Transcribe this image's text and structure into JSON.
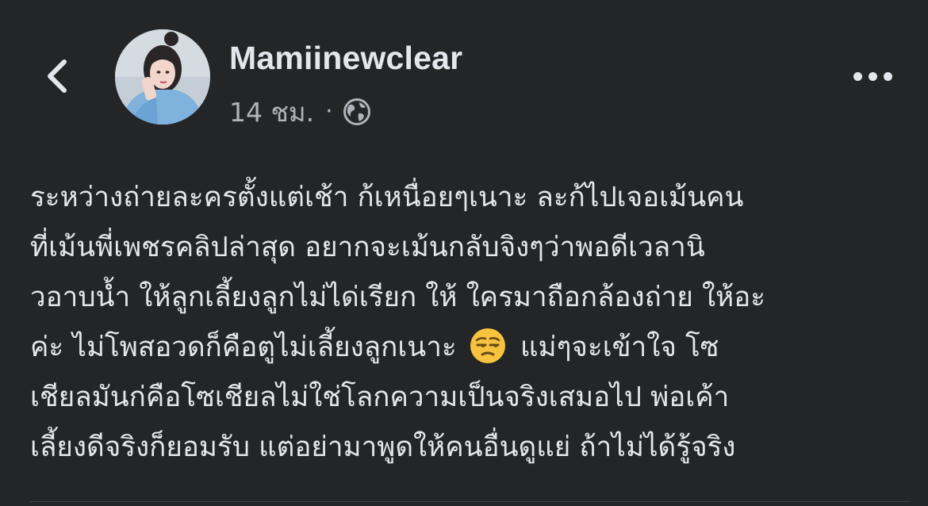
{
  "header": {
    "back_icon": "chevron-left-icon",
    "author_name": "Mamiinewclear",
    "timestamp": "14 ชม.",
    "separator": "·",
    "privacy_icon": "globe-icon",
    "more_icon": "more-horizontal-icon"
  },
  "post": {
    "lines": [
      "ระหว่างถ่ายละครตั้งแต่เช้า ก้เหนื่อยๆเนาะ ละก้ไปเจอเม้นคน",
      "ที่เม้นพี่เพชรคลิปล่าสุด อยากจะเม้นกลับจิงๆว่าพอดีเวลานิ",
      "วอาบน้ำ ให้ลูกเลี้ยงลูกไม่ได่เรียก ให้ ใครมาถือกล้องถ่าย ให้อะ"
    ],
    "line4_before": "ค่ะ ไม่โพสอวดก็คือตูไม่เลี้ยงลูกเนาะ",
    "line4_emoji": "unamused-face-emoji",
    "line4_after": "แม่ๆจะเข้าใจ โซ",
    "lines_end": [
      "เชียลมันก่คือโซเชียลไม่ใช่โลกความเป็นจริงเสมอไป พ่อเค้า",
      "เลี้ยงดีจริงก็ยอมรับ แต่อย่ามาพูดให้คนอื่นดูแย่ ถ้าไม่ได้รู้จริง"
    ]
  },
  "colors": {
    "background": "#242526",
    "primary_text": "#e4e6eb",
    "secondary_text": "#b0b3b8"
  }
}
